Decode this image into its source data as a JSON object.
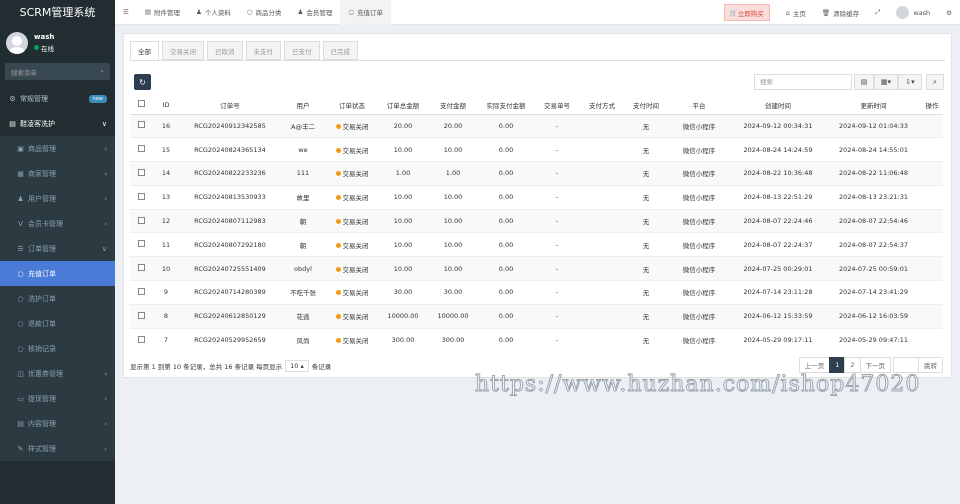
{
  "app": {
    "title": "SCRM管理系统"
  },
  "user": {
    "name": "wash",
    "status": "在线"
  },
  "sidebar": {
    "search_placeholder": "搜索菜单",
    "items": [
      {
        "label": "常规管理",
        "badge": "new",
        "icon": "gear-icon"
      },
      {
        "label": "鞋凌客洗护",
        "icon": "folder-icon",
        "arrow": "∨"
      },
      {
        "label": "商品管理",
        "icon": "box-icon",
        "arrow": "‹"
      },
      {
        "label": "商家管理",
        "icon": "store-icon",
        "arrow": "‹"
      },
      {
        "label": "用户管理",
        "icon": "user-icon",
        "arrow": "‹"
      },
      {
        "label": "会员卡管理",
        "icon": "vip-icon",
        "arrow": "‹"
      },
      {
        "label": "订单管理",
        "icon": "list-icon",
        "arrow": "∨"
      },
      {
        "label": "充值订单",
        "icon": "circle-icon"
      },
      {
        "label": "洗护订单",
        "icon": "circle-icon"
      },
      {
        "label": "退款订单",
        "icon": "circle-icon"
      },
      {
        "label": "核销记录",
        "icon": "circle-icon"
      },
      {
        "label": "优惠券管理",
        "icon": "coupon-icon",
        "arrow": "‹"
      },
      {
        "label": "提现管理",
        "icon": "wallet-icon",
        "arrow": "‹"
      },
      {
        "label": "内容管理",
        "icon": "content-icon",
        "arrow": "‹"
      },
      {
        "label": "样式管理",
        "icon": "style-icon",
        "arrow": "‹"
      }
    ]
  },
  "topbar": {
    "tabs": [
      "附件管理",
      "个人资料",
      "商品分类",
      "会员管理",
      "充值订单"
    ],
    "buy": "立即购买",
    "home": "主页",
    "clear_cache": "清除缓存",
    "username": "wash"
  },
  "filter_tabs": [
    "全部",
    "交易关闭",
    "已取消",
    "未支付",
    "已支付",
    "已完成"
  ],
  "search_placeholder": "搜索",
  "table": {
    "headers": [
      "ID",
      "订单号",
      "用户",
      "订单状态",
      "订单总金额",
      "支付金额",
      "实际支付金额",
      "交易单号",
      "支付方式",
      "支付时间",
      "平台",
      "创建时间",
      "更新时间",
      "操作"
    ],
    "rows": [
      {
        "id": "16",
        "order_no": "RCG20240912342585",
        "user": "A@丰二",
        "status": "交易关闭",
        "total": "20.00",
        "paid": "20.00",
        "actual": "0.00",
        "trade_no": "-",
        "pay_method": "",
        "pay_time": "无",
        "platform": "微信小程序",
        "created": "2024-09-12 00:34:31",
        "updated": "2024-09-12 01:04:33"
      },
      {
        "id": "15",
        "order_no": "RCG20240824365134",
        "user": "we",
        "status": "交易关闭",
        "total": "10.00",
        "paid": "10.00",
        "actual": "0.00",
        "trade_no": "-",
        "pay_method": "",
        "pay_time": "无",
        "platform": "微信小程序",
        "created": "2024-08-24 14:24:59",
        "updated": "2024-08-24 14:55:01"
      },
      {
        "id": "14",
        "order_no": "RCG20240822233236",
        "user": "111",
        "status": "交易关闭",
        "total": "1.00",
        "paid": "1.00",
        "actual": "0.00",
        "trade_no": "-",
        "pay_method": "",
        "pay_time": "无",
        "platform": "微信小程序",
        "created": "2024-08-22 10:36:48",
        "updated": "2024-08-22 11:06:48"
      },
      {
        "id": "13",
        "order_no": "RCG20240813530933",
        "user": "故里",
        "status": "交易关闭",
        "total": "10.00",
        "paid": "10.00",
        "actual": "0.00",
        "trade_no": "-",
        "pay_method": "",
        "pay_time": "无",
        "platform": "微信小程序",
        "created": "2024-08-13 22:51:29",
        "updated": "2024-08-13 23:21:31"
      },
      {
        "id": "12",
        "order_no": "RCG20240807112983",
        "user": "朝",
        "status": "交易关闭",
        "total": "10.00",
        "paid": "10.00",
        "actual": "0.00",
        "trade_no": "-",
        "pay_method": "",
        "pay_time": "无",
        "platform": "微信小程序",
        "created": "2024-08-07 22:24:46",
        "updated": "2024-08-07 22:54:46"
      },
      {
        "id": "11",
        "order_no": "RCG20240807292180",
        "user": "朝",
        "status": "交易关闭",
        "total": "10.00",
        "paid": "10.00",
        "actual": "0.00",
        "trade_no": "-",
        "pay_method": "",
        "pay_time": "无",
        "platform": "微信小程序",
        "created": "2024-08-07 22:24:37",
        "updated": "2024-08-07 22:54:37"
      },
      {
        "id": "10",
        "order_no": "RCG20240725551409",
        "user": "obdyl",
        "status": "交易关闭",
        "total": "10.00",
        "paid": "10.00",
        "actual": "0.00",
        "trade_no": "-",
        "pay_method": "",
        "pay_time": "无",
        "platform": "微信小程序",
        "created": "2024-07-25 00:29:01",
        "updated": "2024-07-25 00:59:01"
      },
      {
        "id": "9",
        "order_no": "RCG20240714280389",
        "user": "不吃千张",
        "status": "交易关闭",
        "total": "30.00",
        "paid": "30.00",
        "actual": "0.00",
        "trade_no": "-",
        "pay_method": "",
        "pay_time": "无",
        "platform": "微信小程序",
        "created": "2024-07-14 23:11:28",
        "updated": "2024-07-14 23:41:29"
      },
      {
        "id": "8",
        "order_no": "RCG20240612850129",
        "user": "花逃",
        "status": "交易关闭",
        "total": "10000.00",
        "paid": "10000.00",
        "actual": "0.00",
        "trade_no": "-",
        "pay_method": "",
        "pay_time": "无",
        "platform": "微信小程序",
        "created": "2024-06-12 15:33:59",
        "updated": "2024-06-12 16:03:59"
      },
      {
        "id": "7",
        "order_no": "RCG20240529952659",
        "user": "风尚",
        "status": "交易关闭",
        "total": "300.00",
        "paid": "300.00",
        "actual": "0.00",
        "trade_no": "-",
        "pay_method": "",
        "pay_time": "无",
        "platform": "微信小程序",
        "created": "2024-05-29 09:17:11",
        "updated": "2024-05-29 09:47:11"
      }
    ]
  },
  "pagination": {
    "summary": "显示第 1 到第 10 条记录，总共 16 条记录 每页显示",
    "page_size": "10",
    "suffix": "条记录",
    "prev": "上一页",
    "pages": [
      "1",
      "2"
    ],
    "next": "下一页",
    "jump": "跳转"
  },
  "watermark": "https://www.huzhan.com/ishop47020"
}
